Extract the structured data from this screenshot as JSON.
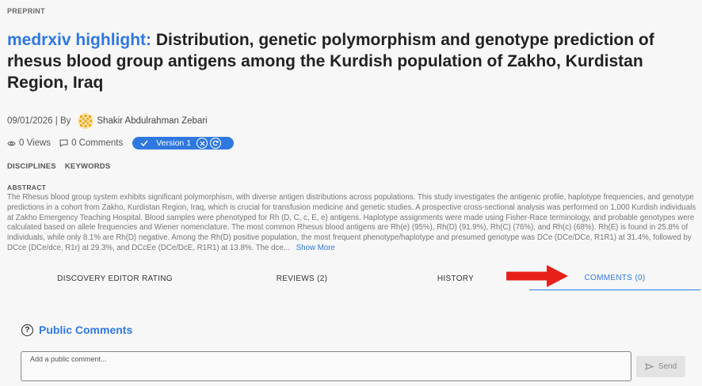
{
  "header": {
    "label": "PREPRINT",
    "title_highlight": "medrxiv highlight:",
    "title": "Distribution, genetic polymorphism and genotype prediction of rhesus blood group antigens among the Kurdish population of Zakho, Kurdistan Region, Iraq"
  },
  "meta": {
    "date": "09/01/2026",
    "by_label": "| By",
    "author": "Shakir Abdulrahman Zebari"
  },
  "stats": {
    "views": "0 Views",
    "comments": "0 Comments",
    "version": "Version 1"
  },
  "tags": {
    "disciplines": "DISCIPLINES",
    "keywords": "KEYWORDS"
  },
  "abstract": {
    "label": "ABSTRACT",
    "text": "The Rhesus blood group system exhibits significant polymorphism, with diverse antigen distributions across populations. This study investigates the antigenic profile, haplotype frequencies, and genotype predictions in a cohort from Zakho, Kurdistan Region, Iraq, which is crucial for transfusion medicine and genetic studies. A prospective cross-sectional analysis was performed on 1,000 Kurdish individuals at Zakho Emergency Teaching Hospital. Blood samples were phenotyped for Rh (D, C, c, E, e) antigens. Haplotype assignments were made using Fisher-Race terminology, and probable genotypes were calculated based on allele frequencies and Wiener nomenclature. The most common Rhesus blood antigens are Rh(e) (95%), Rh(D) (91.9%), Rh(C) (76%), and Rh(c) (68%). Rh(E) is found in 25.8% of individuals, while only 8.1% are Rh(D) negative. Among the Rh(D) positive population, the most frequent phenotype/haplotype and presumed genotype was DCe (DCe/DCe, R1R1) at 31.4%, followed by DCce (DCe/dce, R1r) at 29.3%, and DCcEe (DCe/DcE, R1R1) at 13.8%. The dce...",
    "show_more": "Show More"
  },
  "tabs": [
    {
      "label": "DISCOVERY EDITOR RATING"
    },
    {
      "label": "REVIEWS (2)"
    },
    {
      "label": "HISTORY"
    },
    {
      "label": "COMMENTS (0)"
    }
  ],
  "comments": {
    "title": "Public Comments",
    "placeholder": "Add a public comment...",
    "send": "Send"
  },
  "colors": {
    "accent": "#2f78e0",
    "annotation_arrow": "#e8201a",
    "avatar": "#f2a516"
  },
  "icons": [
    "eye-icon",
    "comment-icon",
    "check-icon",
    "close-circle-icon",
    "refresh-circle-icon",
    "help-icon",
    "send-icon",
    "avatar-icon",
    "red-arrow-icon"
  ]
}
